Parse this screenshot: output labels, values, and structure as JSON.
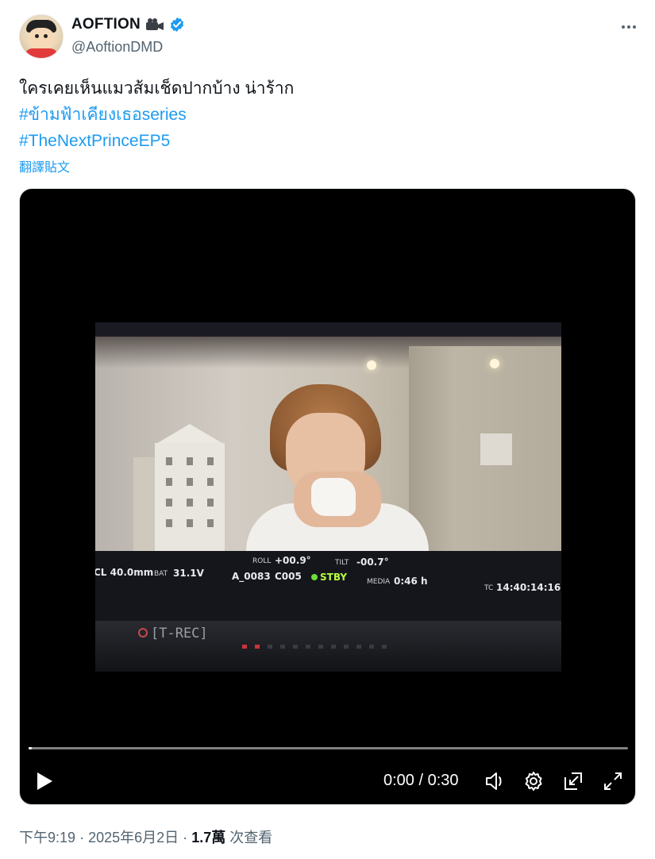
{
  "author": {
    "display_name": "AOFTION",
    "handle": "@AoftionDMD",
    "verified": true,
    "name_emoji": "movie-camera-icon",
    "avatar": "crayon-shinchan-avatar"
  },
  "tweet": {
    "text_line": "ใครเคยเห็นแมวส้มเช็ดปากบ้าง น่าร้าก",
    "hashtags": [
      "#ข้ามฟ้าเคียงเธอseries",
      "#TheNextPrinceEP5"
    ],
    "translate_label": "翻譯貼文"
  },
  "video": {
    "monitor_overlay": {
      "cl": "CL 40.0mm",
      "bat_label": "BAT",
      "bat_value": "31.1V",
      "roll_label": "ROLL",
      "roll_value": "+00.9°",
      "clip": "A_0083",
      "card": "C005",
      "status": "STBY",
      "tilt_label": "TILT",
      "tilt_value": "-00.7°",
      "media_label": "MEDIA",
      "media_value": "0:46 h",
      "tc_label": "TC",
      "tc_value": "14:40:14:16",
      "rec_label": "[T-REC]"
    },
    "current_time": "0:00",
    "duration": "0:30",
    "time_display": "0:00 / 0:30",
    "progress": 0.005
  },
  "meta": {
    "time": "下午9:19",
    "date": "2025年6月2日",
    "separator": "·",
    "views_count": "1.7萬",
    "views_label": "次查看"
  },
  "colors": {
    "link": "#1d9bf0",
    "secondary_text": "#536471",
    "primary_text": "#0f1419",
    "verified": "#1d9bf0",
    "video_bg": "#000000"
  }
}
